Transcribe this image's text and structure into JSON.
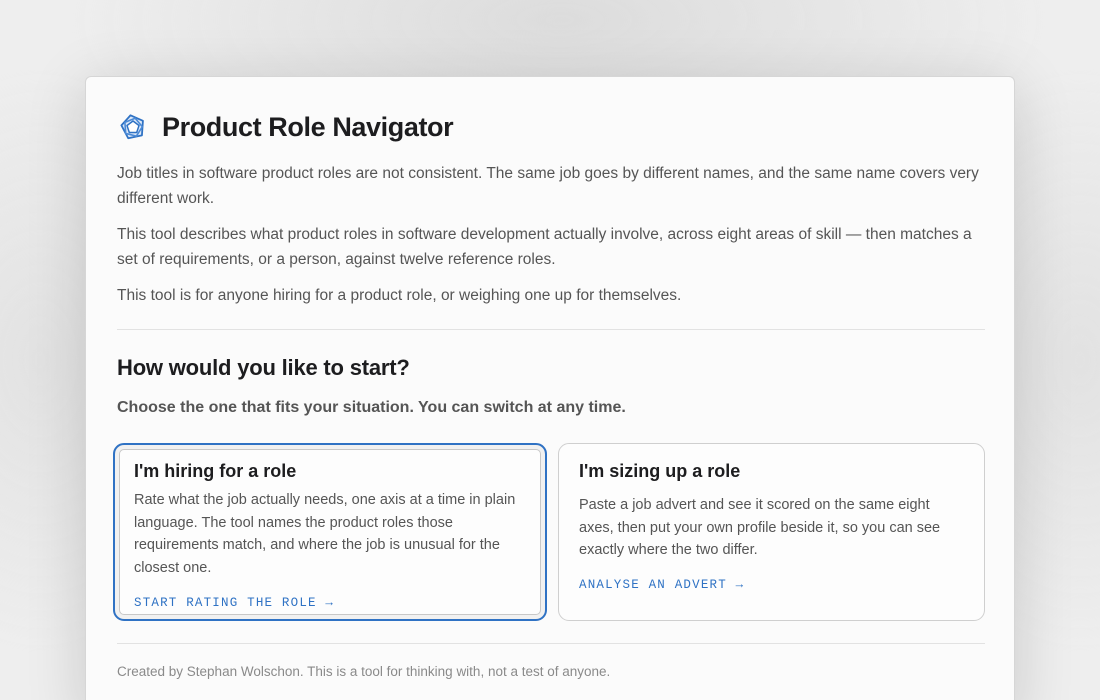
{
  "app": {
    "title": "Product Role Navigator",
    "logo_icon": "pentagon-swirl-logo-icon",
    "accent_color": "#2f72c4"
  },
  "intro": {
    "paragraphs": [
      "Job titles in software product roles are not consistent. The same job goes by different names, and the same name covers very different work.",
      "This tool describes what product roles in software development actually involve, across eight areas of skill — then matches a set of requirements, or a person, against twelve reference roles.",
      "This tool is for anyone hiring for a product role, or weighing one up for themselves."
    ]
  },
  "start": {
    "heading": "How would you like to start?",
    "subheading": "Choose the one that fits your situation. You can switch at any time.",
    "options": [
      {
        "title": "I'm hiring for a role",
        "description": "Rate what the job actually needs, one axis at a time in plain language. The tool names the product roles those requirements match, and where the job is unusual for the closest one.",
        "action": "START RATING THE ROLE →",
        "selected": true
      },
      {
        "title": "I'm sizing up a role",
        "description": "Paste a job advert and see it scored on the same eight axes, then put your own profile beside it, so you can see exactly where the two differ.",
        "action": "ANALYSE AN ADVERT →",
        "selected": false
      }
    ]
  },
  "footer": {
    "text": "Created by Stephan Wolschon. This is a tool for thinking with, not a test of anyone."
  }
}
